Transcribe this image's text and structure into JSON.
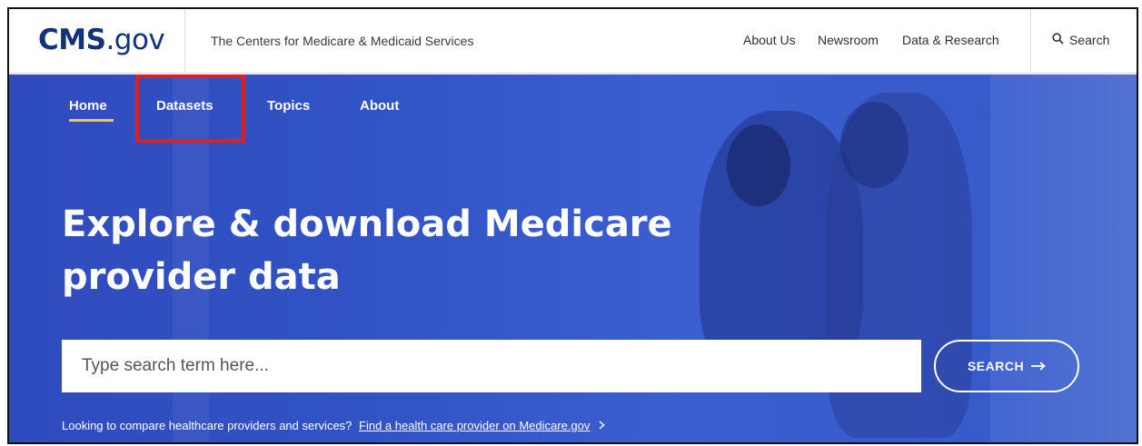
{
  "header": {
    "logo_bold": "CMS",
    "logo_suffix": ".gov",
    "tagline": "The Centers for Medicare & Medicaid Services",
    "utility_links": [
      "About Us",
      "Newsroom",
      "Data & Research"
    ],
    "search_label": "Search",
    "search_icon": "search-icon"
  },
  "nav": {
    "items": [
      "Home",
      "Datasets",
      "Topics",
      "About"
    ],
    "active": "Home",
    "highlighted": "Datasets"
  },
  "hero": {
    "headline_line1": "Explore & download Medicare",
    "headline_line2": "provider data",
    "search_placeholder": "Type search term here...",
    "search_button": "SEARCH",
    "search_button_icon": "arrow-right-icon",
    "compare_text": "Looking to compare healthcare providers and services?",
    "compare_link": "Find a health care provider on Medicare.gov",
    "compare_link_icon": "chevron-right-icon"
  },
  "colors": {
    "brand": "#12327a",
    "hero_blue": "#3254c6",
    "active_underline": "#f4c542",
    "highlight": "#e02020"
  }
}
